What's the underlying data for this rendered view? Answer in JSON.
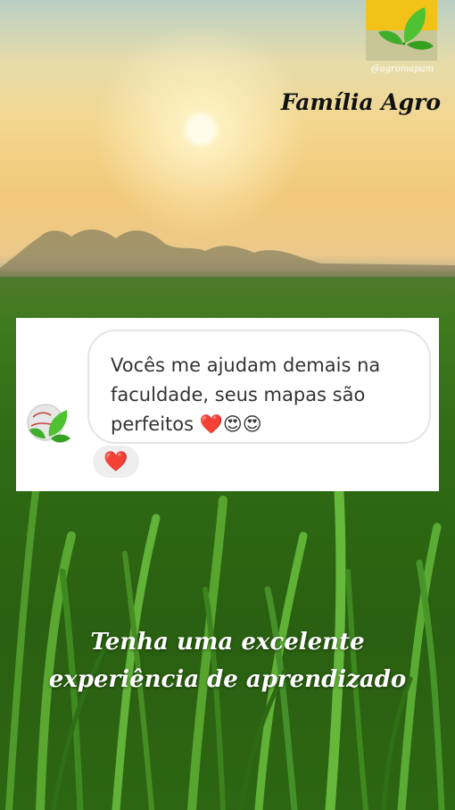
{
  "brand": {
    "title": "Família Agro",
    "handle": "@agromapam",
    "logo_icon": "leaf-icon"
  },
  "comment": {
    "text": "Vocês me ajudam demais na faculdade, seus mapas são perfeitos ❤️😍😍",
    "reaction": "❤️",
    "avatar_icon": "leaf-globe-icon"
  },
  "tagline": {
    "line1": "Tenha uma excelente",
    "line2": "experiência de aprendizado"
  },
  "colors": {
    "logo_yellow": "#f3c218",
    "leaf_green": "#3fae2a",
    "grass_green": "#2f6b14"
  }
}
